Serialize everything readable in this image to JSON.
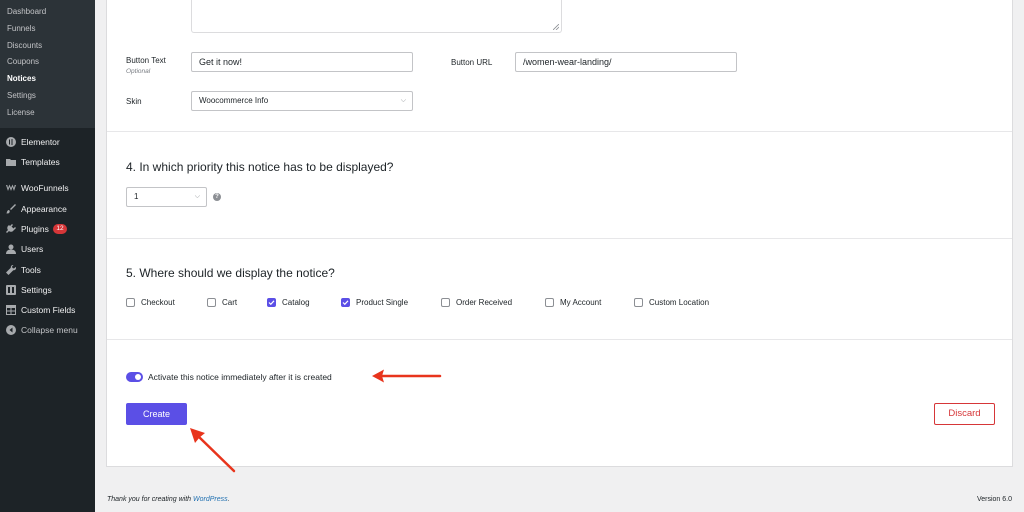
{
  "sidebar": {
    "submenu": [
      {
        "label": "Dashboard",
        "active": false
      },
      {
        "label": "Funnels",
        "active": false
      },
      {
        "label": "Discounts",
        "active": false
      },
      {
        "label": "Coupons",
        "active": false
      },
      {
        "label": "Notices",
        "active": true
      },
      {
        "label": "Settings",
        "active": false
      },
      {
        "label": "License",
        "active": false
      }
    ],
    "menu": [
      {
        "label": "Elementor",
        "icon": "elementor-icon"
      },
      {
        "label": "Templates",
        "icon": "folder-icon"
      },
      {
        "label": "WooFunnels",
        "icon": "woofunnels-icon"
      },
      {
        "label": "Appearance",
        "icon": "brush-icon"
      },
      {
        "label": "Plugins",
        "icon": "plug-icon",
        "badge": "12"
      },
      {
        "label": "Users",
        "icon": "user-icon"
      },
      {
        "label": "Tools",
        "icon": "wrench-icon"
      },
      {
        "label": "Settings",
        "icon": "settings-icon"
      },
      {
        "label": "Custom Fields",
        "icon": "table-icon"
      },
      {
        "label": "Collapse menu",
        "icon": "collapse-icon"
      }
    ]
  },
  "form": {
    "button_text": {
      "label": "Button Text",
      "sublabel": "Optional",
      "value": "Get it now!"
    },
    "button_url": {
      "label": "Button URL",
      "value": "/women-wear-landing/"
    },
    "skin": {
      "label": "Skin",
      "value": "Woocommerce Info"
    },
    "priority": {
      "heading": "4. In which priority this notice has to be displayed?",
      "value": "1",
      "help": "?"
    },
    "display": {
      "heading": "5. Where should we display the notice?",
      "options": [
        {
          "label": "Checkout",
          "checked": false
        },
        {
          "label": "Cart",
          "checked": false
        },
        {
          "label": "Catalog",
          "checked": true
        },
        {
          "label": "Product Single",
          "checked": true
        },
        {
          "label": "Order Received",
          "checked": false
        },
        {
          "label": "My Account",
          "checked": false
        },
        {
          "label": "Custom Location",
          "checked": false
        }
      ]
    },
    "activate": {
      "label": "Activate this notice immediately after it is created",
      "enabled": true
    },
    "create_label": "Create",
    "discard_label": "Discard"
  },
  "footer": {
    "thanks_prefix": "Thank you for creating with ",
    "thanks_link": "WordPress",
    "thanks_suffix": ".",
    "version": "Version 6.0"
  },
  "colors": {
    "accent": "#5b4fe6",
    "danger": "#d63638",
    "sidebar_bg": "#1d2327",
    "annotation_arrow": "#e8341c"
  }
}
